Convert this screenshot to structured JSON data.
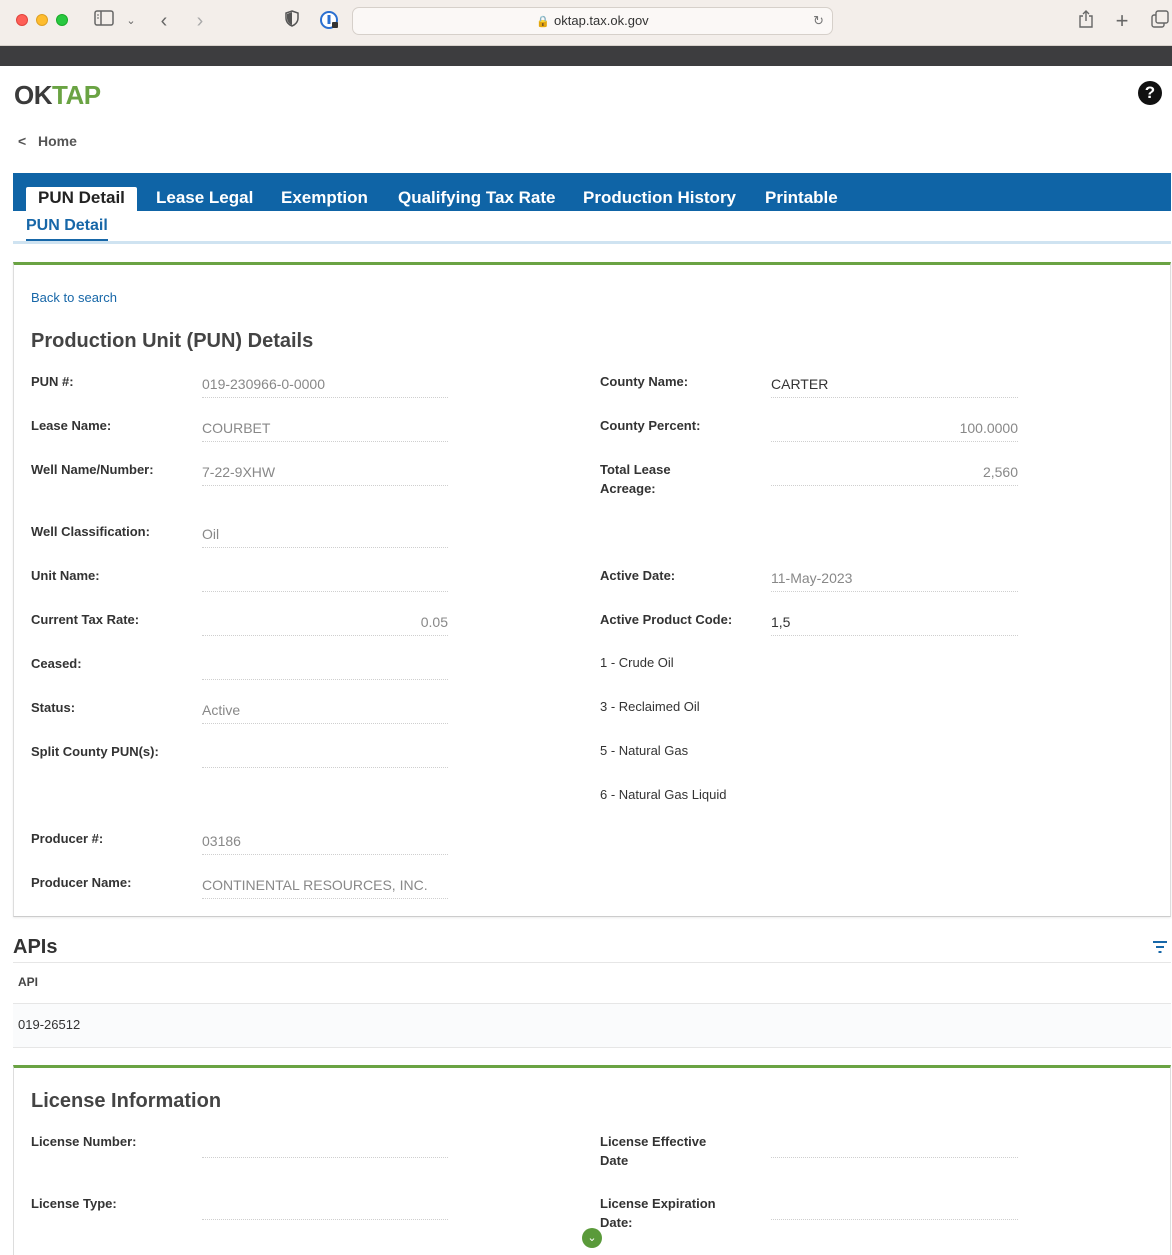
{
  "browser": {
    "url": "oktap.tax.ok.gov"
  },
  "header": {
    "logo_ok": "OK",
    "logo_tap": "TAP",
    "help": "?",
    "home": "Home"
  },
  "tabs": [
    "PUN Detail",
    "Lease Legal",
    "Exemption",
    "Qualifying Tax Rate",
    "Production History",
    "Printable"
  ],
  "subtab": "PUN Detail",
  "pun": {
    "back": "Back to search",
    "title": "Production Unit (PUN) Details",
    "left": [
      {
        "label": "PUN #:",
        "value": "019-230966-0-0000"
      },
      {
        "label": "Lease Name:",
        "value": "COURBET"
      },
      {
        "label": "Well Name/Number:",
        "value": "7-22-9XHW"
      },
      {
        "label": "Well Classification:",
        "value": "Oil"
      },
      {
        "label": "Unit Name:",
        "value": ""
      },
      {
        "label": "Current Tax Rate:",
        "value": "0.05"
      },
      {
        "label": "Ceased:",
        "value": ""
      },
      {
        "label": "Status:",
        "value": "Active"
      },
      {
        "label": "Split County PUN(s):",
        "value": ""
      },
      {
        "label": "Producer #:",
        "value": "03186"
      },
      {
        "label": "Producer Name:",
        "value": "CONTINENTAL RESOURCES, INC."
      }
    ],
    "right": [
      {
        "label": "County Name:",
        "value": "CARTER"
      },
      {
        "label": "County Percent:",
        "value": "100.0000"
      },
      {
        "label": "Total Lease Acreage:",
        "value": "2,560"
      },
      {
        "label": "Active Date:",
        "value": "11-May-2023"
      },
      {
        "label": "Active Product Code:",
        "value": "1,5"
      }
    ],
    "product_codes": [
      "1 - Crude Oil",
      "3 - Reclaimed Oil",
      "5 - Natural Gas",
      "6 - Natural Gas Liquid"
    ]
  },
  "apis": {
    "title": "APIs",
    "column": "API",
    "rows": [
      "019-26512"
    ]
  },
  "license": {
    "title": "License Information",
    "fields": [
      {
        "label": "License Number:",
        "value": ""
      },
      {
        "label": "License Effective Date",
        "value": ""
      },
      {
        "label": "License Type:",
        "value": ""
      },
      {
        "label": "License Expiration Date:",
        "value": ""
      }
    ]
  }
}
